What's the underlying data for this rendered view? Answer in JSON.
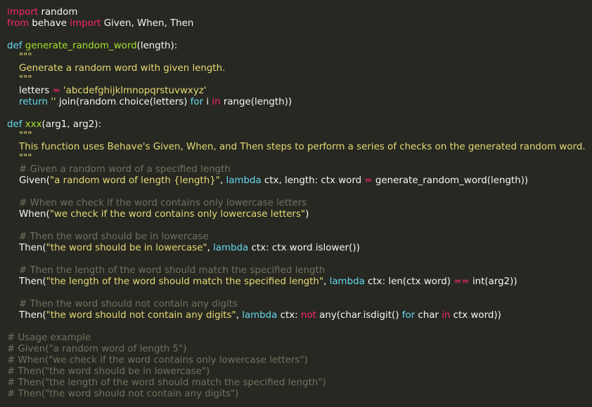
{
  "theme": {
    "background": "#272822",
    "foreground": "#f8f8f2",
    "keyword": "#f92672",
    "storage": "#66d9ef",
    "function": "#a6e22e",
    "string": "#e6db74",
    "comment": "#75715e"
  },
  "lines": [
    [
      {
        "t": "import",
        "k": "kw"
      },
      {
        "t": " random",
        "k": "pl"
      }
    ],
    [
      {
        "t": "from",
        "k": "kw"
      },
      {
        "t": " behave ",
        "k": "pl"
      },
      {
        "t": "import",
        "k": "kw"
      },
      {
        "t": " Given, When, Then",
        "k": "pl"
      }
    ],
    [],
    [
      {
        "t": "def",
        "k": "def"
      },
      {
        "t": " ",
        "k": "pl"
      },
      {
        "t": "generate_random_word",
        "k": "fn"
      },
      {
        "t": "(length):",
        "k": "pl"
      }
    ],
    [
      {
        "t": "    \"\"\"",
        "k": "str"
      }
    ],
    [
      {
        "t": "    Generate a random word with given length.",
        "k": "str"
      }
    ],
    [
      {
        "t": "    \"\"\"",
        "k": "str"
      }
    ],
    [
      {
        "t": "    letters ",
        "k": "pl"
      },
      {
        "t": "=",
        "k": "op"
      },
      {
        "t": " ",
        "k": "pl"
      },
      {
        "t": "'abcdefghijklmnopqrstuvwxyz'",
        "k": "str"
      }
    ],
    [
      {
        "t": "    ",
        "k": "pl"
      },
      {
        "t": "return",
        "k": "def"
      },
      {
        "t": " ",
        "k": "pl"
      },
      {
        "t": "''",
        "k": "str"
      },
      {
        "t": ".",
        "k": "dot"
      },
      {
        "t": "join(random",
        "k": "pl"
      },
      {
        "t": ".",
        "k": "dot"
      },
      {
        "t": "choice(letters) ",
        "k": "pl"
      },
      {
        "t": "for",
        "k": "def"
      },
      {
        "t": " i ",
        "k": "pl"
      },
      {
        "t": "in",
        "k": "kw"
      },
      {
        "t": " range(length))",
        "k": "pl"
      }
    ],
    [],
    [
      {
        "t": "def",
        "k": "def"
      },
      {
        "t": " ",
        "k": "pl"
      },
      {
        "t": "xxx",
        "k": "fn"
      },
      {
        "t": "(arg1, arg2):",
        "k": "pl"
      }
    ],
    [
      {
        "t": "    \"\"\"",
        "k": "str"
      }
    ],
    [
      {
        "t": "    This function uses Behave's Given, When, and Then steps to perform a series of checks on the generated random word.",
        "k": "str"
      }
    ],
    [
      {
        "t": "    \"\"\"",
        "k": "str"
      }
    ],
    [
      {
        "t": "    # Given a random word of a specified length",
        "k": "cm"
      }
    ],
    [
      {
        "t": "    Given(",
        "k": "pl"
      },
      {
        "t": "\"a random word of length {length}\"",
        "k": "str"
      },
      {
        "t": ", ",
        "k": "pl"
      },
      {
        "t": "lambda",
        "k": "def"
      },
      {
        "t": " ctx, length: ctx",
        "k": "pl"
      },
      {
        "t": ".",
        "k": "dot"
      },
      {
        "t": "word ",
        "k": "pl"
      },
      {
        "t": "=",
        "k": "op"
      },
      {
        "t": " generate_random_word(length))",
        "k": "pl"
      }
    ],
    [],
    [
      {
        "t": "    # When we check if the word contains only lowercase letters",
        "k": "cm"
      }
    ],
    [
      {
        "t": "    When(",
        "k": "pl"
      },
      {
        "t": "\"we check if the word contains only lowercase letters\"",
        "k": "str"
      },
      {
        "t": ")",
        "k": "pl"
      }
    ],
    [],
    [
      {
        "t": "    # Then the word should be in lowercase",
        "k": "cm"
      }
    ],
    [
      {
        "t": "    Then(",
        "k": "pl"
      },
      {
        "t": "\"the word should be in lowercase\"",
        "k": "str"
      },
      {
        "t": ", ",
        "k": "pl"
      },
      {
        "t": "lambda",
        "k": "def"
      },
      {
        "t": " ctx: ctx",
        "k": "pl"
      },
      {
        "t": ".",
        "k": "dot"
      },
      {
        "t": "word",
        "k": "pl"
      },
      {
        "t": ".",
        "k": "dot"
      },
      {
        "t": "islower())",
        "k": "pl"
      }
    ],
    [],
    [
      {
        "t": "    # Then the length of the word should match the specified length",
        "k": "cm"
      }
    ],
    [
      {
        "t": "    Then(",
        "k": "pl"
      },
      {
        "t": "\"the length of the word should match the specified length\"",
        "k": "str"
      },
      {
        "t": ", ",
        "k": "pl"
      },
      {
        "t": "lambda",
        "k": "def"
      },
      {
        "t": " ctx: len(ctx",
        "k": "pl"
      },
      {
        "t": ".",
        "k": "dot"
      },
      {
        "t": "word) ",
        "k": "pl"
      },
      {
        "t": "==",
        "k": "op"
      },
      {
        "t": " int(arg2))",
        "k": "pl"
      }
    ],
    [],
    [
      {
        "t": "    # Then the word should not contain any digits",
        "k": "cm"
      }
    ],
    [
      {
        "t": "    Then(",
        "k": "pl"
      },
      {
        "t": "\"the word should not contain any digits\"",
        "k": "str"
      },
      {
        "t": ", ",
        "k": "pl"
      },
      {
        "t": "lambda",
        "k": "def"
      },
      {
        "t": " ctx: ",
        "k": "pl"
      },
      {
        "t": "not",
        "k": "kw"
      },
      {
        "t": " any(char",
        "k": "pl"
      },
      {
        "t": ".",
        "k": "dot"
      },
      {
        "t": "isdigit() ",
        "k": "pl"
      },
      {
        "t": "for",
        "k": "def"
      },
      {
        "t": " char ",
        "k": "pl"
      },
      {
        "t": "in",
        "k": "kw"
      },
      {
        "t": " ctx",
        "k": "pl"
      },
      {
        "t": ".",
        "k": "dot"
      },
      {
        "t": "word))",
        "k": "pl"
      }
    ],
    [],
    [
      {
        "t": "# Usage example",
        "k": "cm"
      }
    ],
    [
      {
        "t": "# Given(\"a random word of length 5\")",
        "k": "cm"
      }
    ],
    [
      {
        "t": "# When(\"we check if the word contains only lowercase letters\")",
        "k": "cm"
      }
    ],
    [
      {
        "t": "# Then(\"the word should be in lowercase\")",
        "k": "cm"
      }
    ],
    [
      {
        "t": "# Then(\"the length of the word should match the specified length\")",
        "k": "cm"
      }
    ],
    [
      {
        "t": "# Then(\"the word should not contain any digits\")",
        "k": "cm"
      }
    ]
  ]
}
